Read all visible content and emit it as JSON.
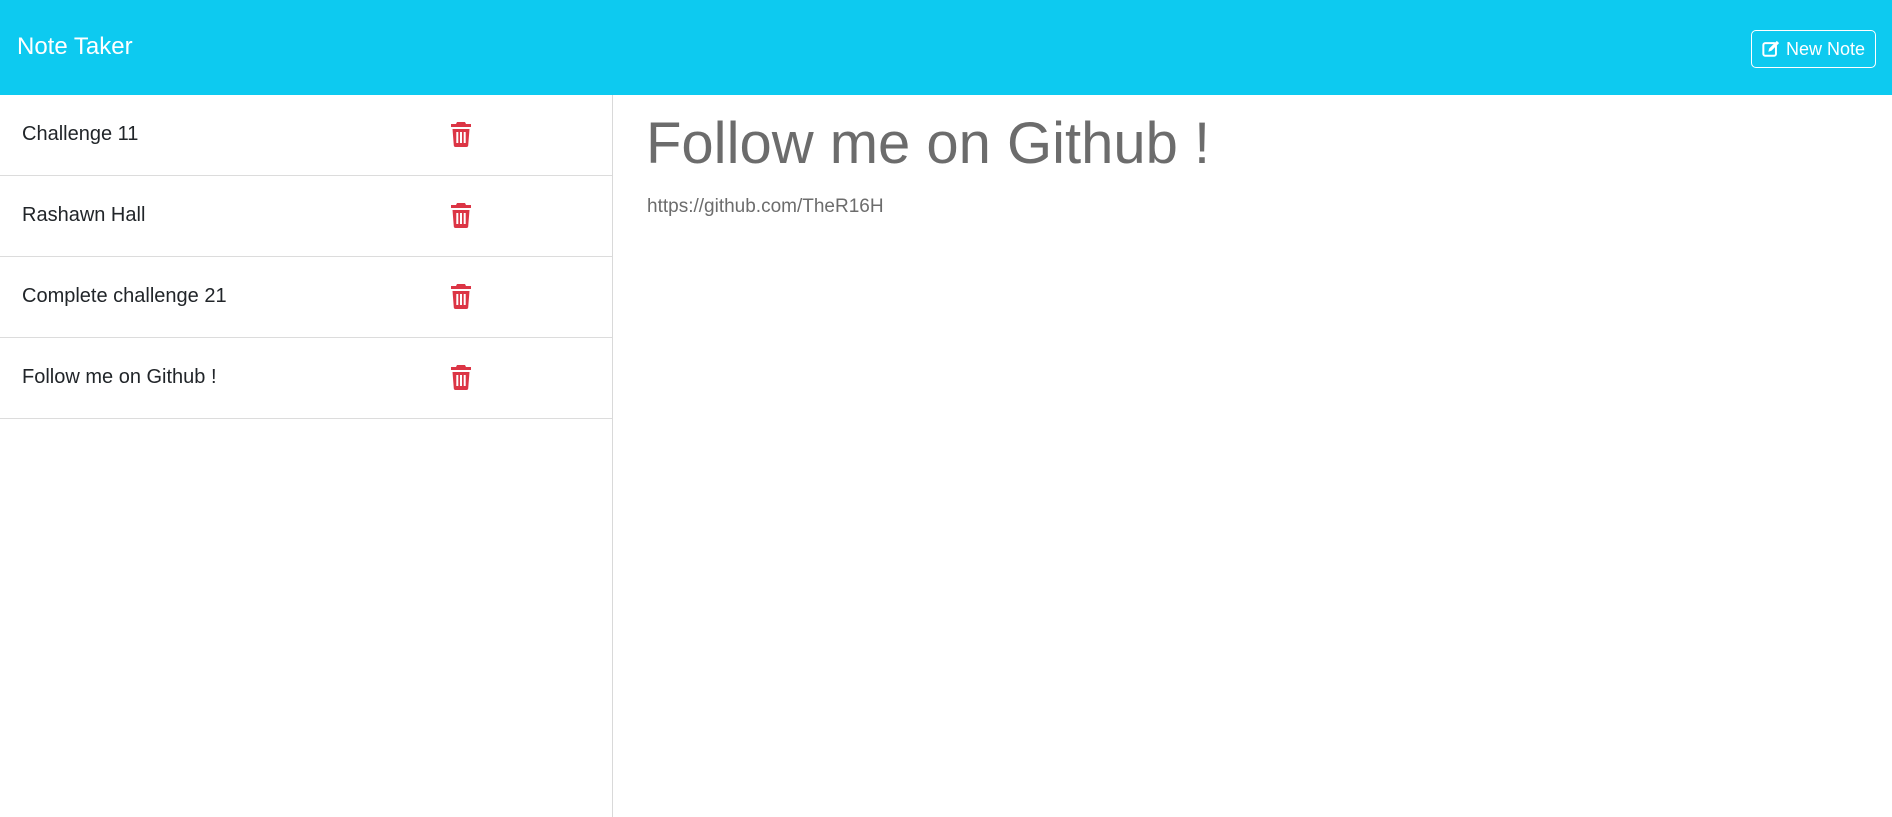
{
  "app": {
    "title": "Note Taker"
  },
  "toolbar": {
    "new_note_label": "New Note",
    "new_note_icon": "pen-to-square-icon"
  },
  "sidebar": {
    "notes": [
      {
        "title": "Challenge 11"
      },
      {
        "title": "Rashawn Hall"
      },
      {
        "title": "Complete challenge 21"
      },
      {
        "title": "Follow me on Github !"
      }
    ],
    "delete_icon": "trash-icon"
  },
  "editor": {
    "title": "Follow me on Github !",
    "body": "https://github.com/TheR16H"
  },
  "colors": {
    "navbar": "#0dcaf0",
    "delete": "#dc3545",
    "heading_text": "#6c6c6c"
  }
}
